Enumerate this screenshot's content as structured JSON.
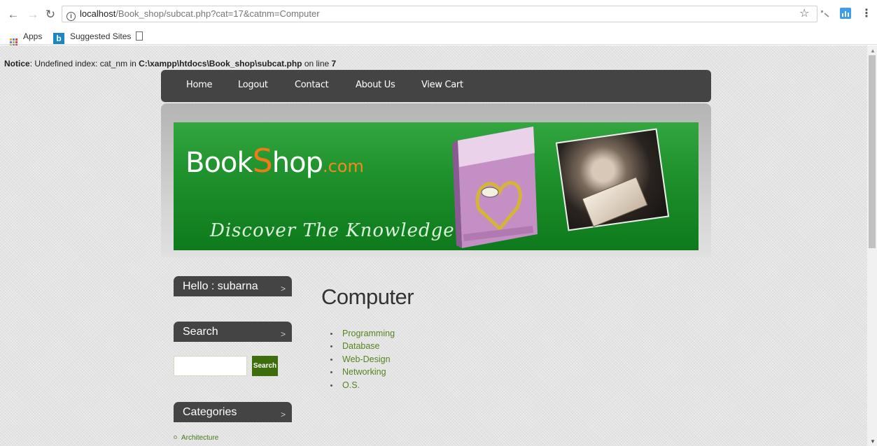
{
  "browser": {
    "url_host": "localhost",
    "url_path": "/Book_shop/subcat.php?cat=17&catnm=Computer",
    "bookmarks": [
      {
        "label": "Apps",
        "icon": "apps-icon"
      },
      {
        "label": "Suggested Sites",
        "icon": "bing-icon"
      }
    ]
  },
  "notice": {
    "label": "Notice",
    "message_1": ": Undefined index: cat_nm in ",
    "path": "C:\\xampp\\htdocs\\Book_shop\\subcat.php",
    "message_2": " on line ",
    "line": "7"
  },
  "nav": {
    "items": [
      "Home",
      "Logout",
      "Contact",
      "About Us",
      "View Cart"
    ]
  },
  "banner": {
    "logo_book": "Book",
    "logo_s": "S",
    "logo_hop": "hop",
    "logo_com": ".com",
    "tagline": "Discover The Knowledge"
  },
  "sidebar": {
    "greeting": "Hello : subarna",
    "search_title": "Search",
    "search_button": "Search",
    "search_value": "",
    "categories_title": "Categories",
    "categories": [
      "Architecture"
    ]
  },
  "main": {
    "title": "Computer",
    "subcategories": [
      "Programming",
      "Database",
      "Web-Design",
      "Networking",
      "O.S."
    ]
  },
  "colors": {
    "nav_bg": "#444444",
    "banner_green": "#1d8f2a",
    "logo_orange": "#f17a17",
    "link_green": "#53861e",
    "search_button_bg": "#3e6e0c"
  }
}
